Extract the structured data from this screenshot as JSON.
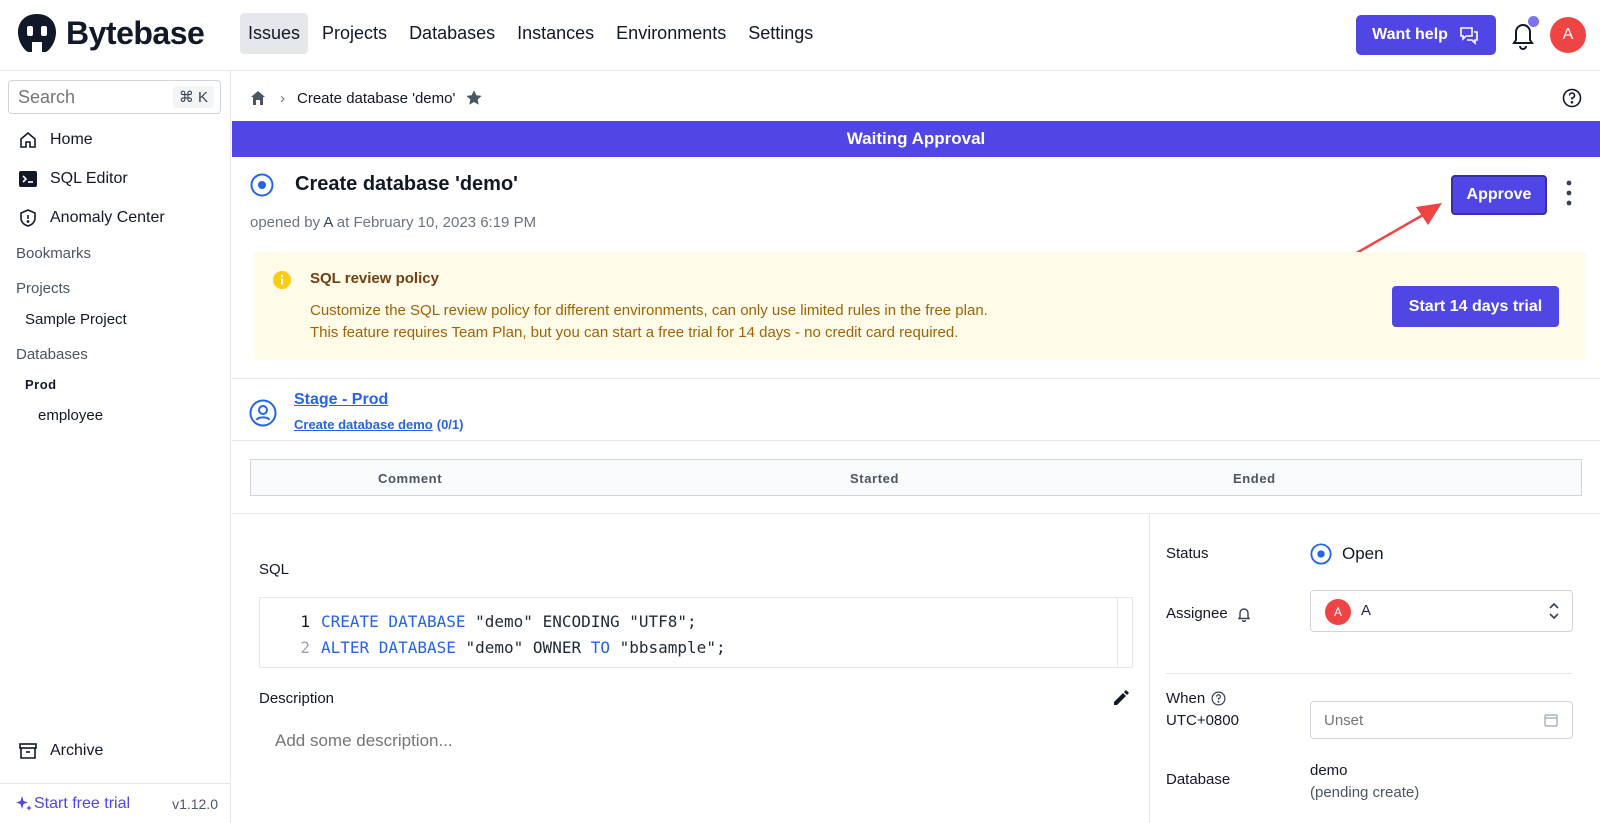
{
  "app": {
    "name": "Bytebase",
    "nav": [
      "Issues",
      "Projects",
      "Databases",
      "Instances",
      "Environments",
      "Settings"
    ],
    "active_nav": "Issues",
    "help_label": "Want help",
    "user_initial": "A"
  },
  "sidebar": {
    "search_placeholder": "Search",
    "shortcut": "⌘ K",
    "items": [
      {
        "label": "Home",
        "icon": "home-icon"
      },
      {
        "label": "SQL Editor",
        "icon": "terminal-icon"
      },
      {
        "label": "Anomaly Center",
        "icon": "shield-icon"
      }
    ],
    "bookmarks": "Bookmarks",
    "projects_heading": "Projects",
    "project": "Sample Project",
    "databases_heading": "Databases",
    "environment": "Prod",
    "database": "employee",
    "archive": "Archive",
    "trial_label": "Start free trial",
    "version": "v1.12.0"
  },
  "breadcrumb": {
    "current": "Create database 'demo'"
  },
  "banner": "Waiting Approval",
  "issue": {
    "title": "Create database 'demo'",
    "opened_prefix": "opened by",
    "opened_by": "A",
    "opened_suffix": "at February 10, 2023 6:19 PM",
    "approve_label": "Approve"
  },
  "feature_notice": {
    "title": "SQL review policy",
    "line1": "Customize the SQL review policy for different environments, can only use limited rules in the free plan.",
    "line2": "This feature requires Team Plan, but you can start a free trial for 14 days - no credit card required.",
    "button": "Start 14 days trial"
  },
  "stage": {
    "title": "Stage - Prod",
    "task": "Create database demo",
    "task_count": "(0/1)"
  },
  "task_table": {
    "columns": [
      "Comment",
      "Started",
      "Ended"
    ]
  },
  "sql": {
    "label": "SQL",
    "lines": [
      {
        "num": "1",
        "kw1": "CREATE DATABASE",
        "rest1": " \"demo\" ENCODING \"UTF8\";",
        "kw2": "",
        "rest2": ""
      },
      {
        "num": "2",
        "kw1": "ALTER DATABASE",
        "rest1": " \"demo\" OWNER ",
        "kw2": "TO",
        "rest2": " \"bbsample\";"
      }
    ]
  },
  "description": {
    "label": "Description",
    "placeholder": "Add some description..."
  },
  "details": {
    "status_label": "Status",
    "status_value": "Open",
    "assignee_label": "Assignee",
    "assignee_initial": "A",
    "assignee_name": "A",
    "when_label": "When",
    "timezone": "UTC+0800",
    "when_placeholder": "Unset",
    "database_label": "Database",
    "database_value": "demo",
    "database_note": "(pending create)"
  },
  "colors": {
    "accent": "#4f46e5",
    "notice_bg": "#fefce8",
    "notice_text": "#a16207",
    "link": "#2563eb",
    "avatar": "#ef4444"
  }
}
